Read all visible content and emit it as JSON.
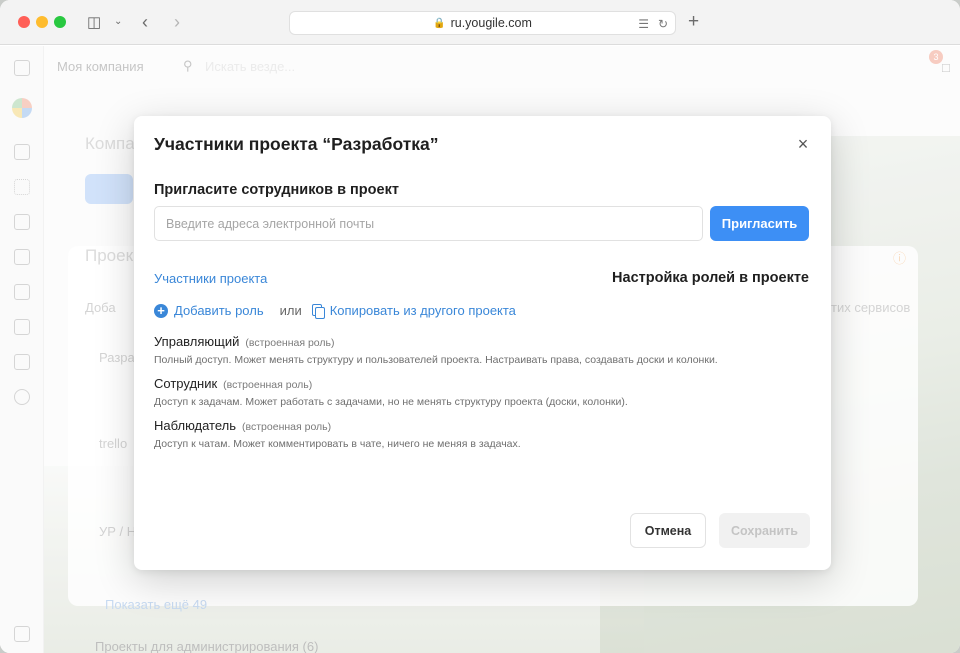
{
  "browser": {
    "url": "ru.yougile.com"
  },
  "background": {
    "company_name": "Моя компания",
    "search_placeholder": "Искать везде...",
    "page_heading": "Компа",
    "projects_heading": "Проек",
    "add_link": "Доба",
    "services_link": "тих сервисов",
    "project_1": "Разра",
    "project_2": "trello",
    "project_3": "УР / Н",
    "show_more": "Показать ещё 49",
    "admin_projects": "Проекты для администрирования (6)",
    "notification_count": "3"
  },
  "modal": {
    "title": "Участники проекта “Разработка”",
    "invite_heading": "Пригласите сотрудников в проект",
    "email_placeholder": "Введите адреса электронной почты",
    "invite_button": "Пригласить",
    "tab_members": "Участники проекта",
    "tab_roles": "Настройка ролей в проекте",
    "add_role": "Добавить роль",
    "or": "или",
    "copy_from_project": "Копировать из другого проекта",
    "roles": [
      {
        "name": "Управляющий",
        "tag": "(встроенная роль)",
        "description": "Полный доступ. Может менять структуру и пользователей проекта. Настраивать права, создавать доски и колонки."
      },
      {
        "name": "Сотрудник",
        "tag": "(встроенная роль)",
        "description": "Доступ к задачам. Может работать с задачами, но не менять структуру проекта (доски, колонки)."
      },
      {
        "name": "Наблюдатель",
        "tag": "(встроенная роль)",
        "description": "Доступ к чатам. Может комментировать в чате, ничего не меняя в задачах."
      }
    ],
    "cancel_button": "Отмена",
    "save_button": "Сохранить"
  }
}
